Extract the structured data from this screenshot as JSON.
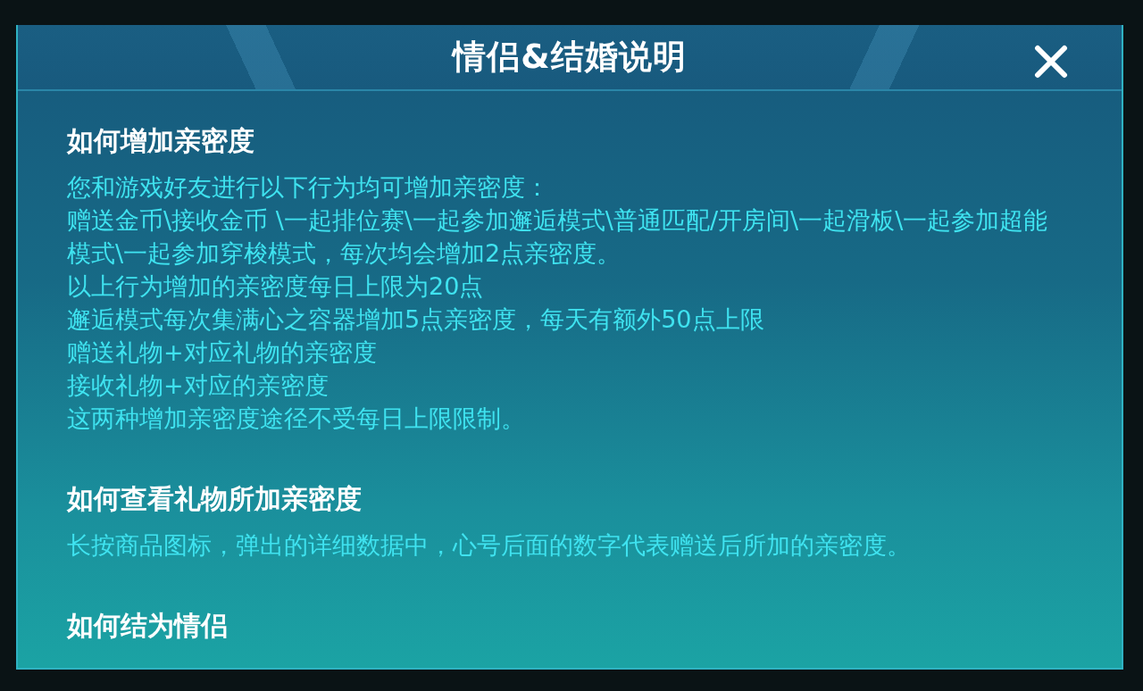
{
  "dialog": {
    "title": "情侣&结婚说明"
  },
  "sections": [
    {
      "heading": "如何增加亲密度",
      "paragraphs": [
        "您和游戏好友进行以下行为均可增加亲密度：",
        "赠送金币\\接收金币 \\一起排位赛\\一起参加邂逅模式\\普通匹配/开房间\\一起滑板\\一起参加超能模式\\一起参加穿梭模式，每次均会增加2点亲密度。",
        "以上行为增加的亲密度每日上限为20点",
        "邂逅模式每次集满心之容器增加5点亲密度，每天有额外50点上限",
        "赠送礼物+对应礼物的亲密度",
        "接收礼物+对应的亲密度",
        "这两种增加亲密度途径不受每日上限限制。"
      ]
    },
    {
      "heading": "如何查看礼物所加亲密度",
      "paragraphs": [
        "长按商品图标，弹出的详细数据中，心号后面的数字代表赠送后所加的亲密度。"
      ]
    },
    {
      "heading": "如何结为情侣"
    }
  ]
}
